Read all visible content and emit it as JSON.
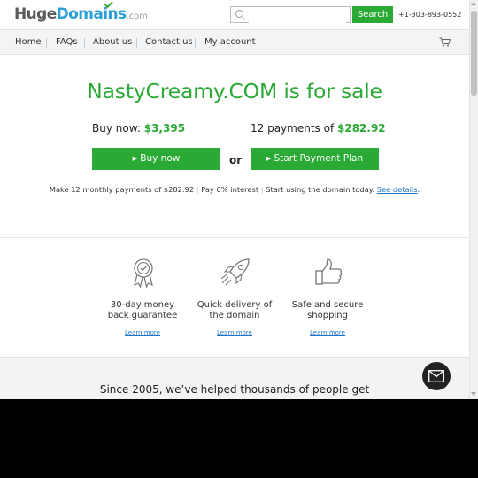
{
  "header": {
    "logo": {
      "huge": "Huge",
      "domains": "Domains",
      "tld": ".com"
    },
    "search": {
      "placeholder": "",
      "button_label": "Search"
    },
    "phone": "+1-303-893-0552"
  },
  "nav": {
    "items": [
      {
        "label": "Home"
      },
      {
        "label": "FAQs"
      },
      {
        "label": "About us"
      },
      {
        "label": "Contact us"
      },
      {
        "label": "My account"
      }
    ]
  },
  "hero": {
    "title": "NastyCreamy.COM is for sale",
    "buy_now_label": "Buy now:",
    "buy_now_price": "$3,395",
    "payments_label": "12 payments of",
    "payments_price": "$282.92",
    "buy_button": "▸ Buy now",
    "or_label": "or",
    "plan_button": "▸ Start Payment Plan",
    "monthly_text_1": "Make 12 monthly payments of $282.92",
    "monthly_text_2": "Pay 0% interest",
    "monthly_text_3": "Start using the domain today.",
    "see_details": "See details",
    "period": "."
  },
  "features": [
    {
      "line1": "30-day money",
      "line2": "back guarantee",
      "link": "Learn more",
      "icon": "award-ribbon-icon"
    },
    {
      "line1": "Quick delivery of",
      "line2": "the domain",
      "link": "Learn more",
      "icon": "rocket-icon"
    },
    {
      "line1": "Safe and secure",
      "line2": "shopping",
      "link": "Learn more",
      "icon": "thumbs-up-icon"
    }
  ],
  "bottom": {
    "since_text": "Since 2005, we’ve helped thousands of people get"
  },
  "colors": {
    "accent": "#2aa935",
    "link": "#1f73c6",
    "logo_blue": "#2a9fd8"
  }
}
